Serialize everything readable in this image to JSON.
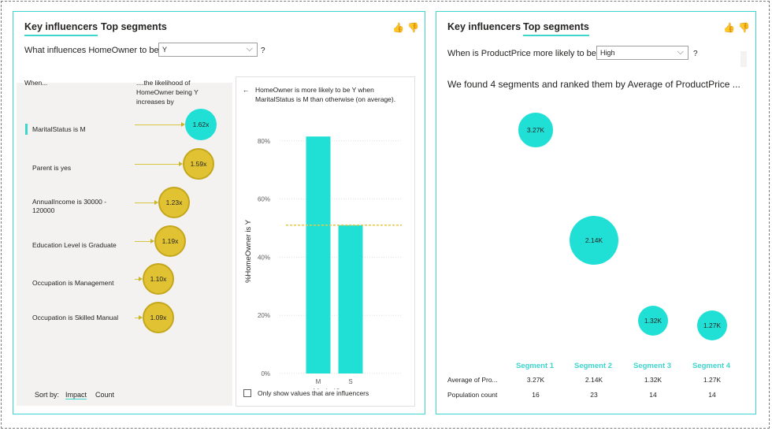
{
  "left": {
    "tabs": [
      "Key influencers",
      "Top segments"
    ],
    "question_prefix": "What influences HomeOwner to be",
    "selected_value": "Y",
    "question_mark": "?",
    "col_when": "When...",
    "col_likelihood": "....the likelihood of HomeOwner being Y increases by",
    "influencers": [
      {
        "label": "MaritalStatus is M",
        "value": "1.62x",
        "selected": true,
        "score": 1.62
      },
      {
        "label": "Parent is yes",
        "value": "1.59x",
        "selected": false,
        "score": 1.59
      },
      {
        "label": "AnnualIncome is 30000 - 120000",
        "value": "1.23x",
        "selected": false,
        "score": 1.23
      },
      {
        "label": "Education Level is Graduate",
        "value": "1.19x",
        "selected": false,
        "score": 1.19
      },
      {
        "label": "Occupation is Management",
        "value": "1.10x",
        "selected": false,
        "score": 1.1
      },
      {
        "label": "Occupation is Skilled Manual",
        "value": "1.09x",
        "selected": false,
        "score": 1.09
      }
    ],
    "sort_by_label": "Sort by:",
    "sort_options": [
      "Impact",
      "Count"
    ],
    "sort_active": "Impact",
    "detail": {
      "back_arrow": "←",
      "description": "HomeOwner is more likely to be Y when MaritalStatus is M than otherwise (on average).",
      "checkbox_label": "Only show values that are influencers"
    }
  },
  "chart_data": {
    "type": "bar",
    "categories": [
      "M",
      "S"
    ],
    "values": [
      81.5,
      51
    ],
    "average_line": 51,
    "xlabel": "MaritalStatus",
    "ylabel": "%HomeOwner is Y",
    "ylim": [
      0,
      84
    ],
    "yticks": [
      0,
      20,
      40,
      60,
      80
    ],
    "ytick_labels": [
      "0%",
      "20%",
      "40%",
      "60%",
      "80%"
    ],
    "bar_color": "#20e0d6",
    "line_color": "#e6c845"
  },
  "right": {
    "tabs": [
      "Key influencers",
      "Top segments"
    ],
    "question_prefix": "When is ProductPrice more likely to be",
    "selected_value": "High",
    "question_mark": "?",
    "summary": "We found 4 segments and ranked them by Average of ProductPrice ...",
    "segments": [
      {
        "name": "Segment 1",
        "avg": "3.27K",
        "avg_value": 3.27,
        "count": "16",
        "count_value": 16
      },
      {
        "name": "Segment 2",
        "avg": "2.14K",
        "avg_value": 2.14,
        "count": "23",
        "count_value": 23
      },
      {
        "name": "Segment 3",
        "avg": "1.32K",
        "avg_value": 1.32,
        "count": "14",
        "count_value": 14
      },
      {
        "name": "Segment 4",
        "avg": "1.27K",
        "avg_value": 1.27,
        "count": "14",
        "count_value": 14
      }
    ],
    "row_avg_label": "Average of Pro...",
    "row_count_label": "Population count"
  },
  "icons": {
    "like": "thumbs-up-icon",
    "dislike": "thumbs-down-icon"
  },
  "colors": {
    "accent": "#3ed5cc",
    "bubble_teal": "#20e0d6",
    "bubble_gold": "#e1c233"
  }
}
